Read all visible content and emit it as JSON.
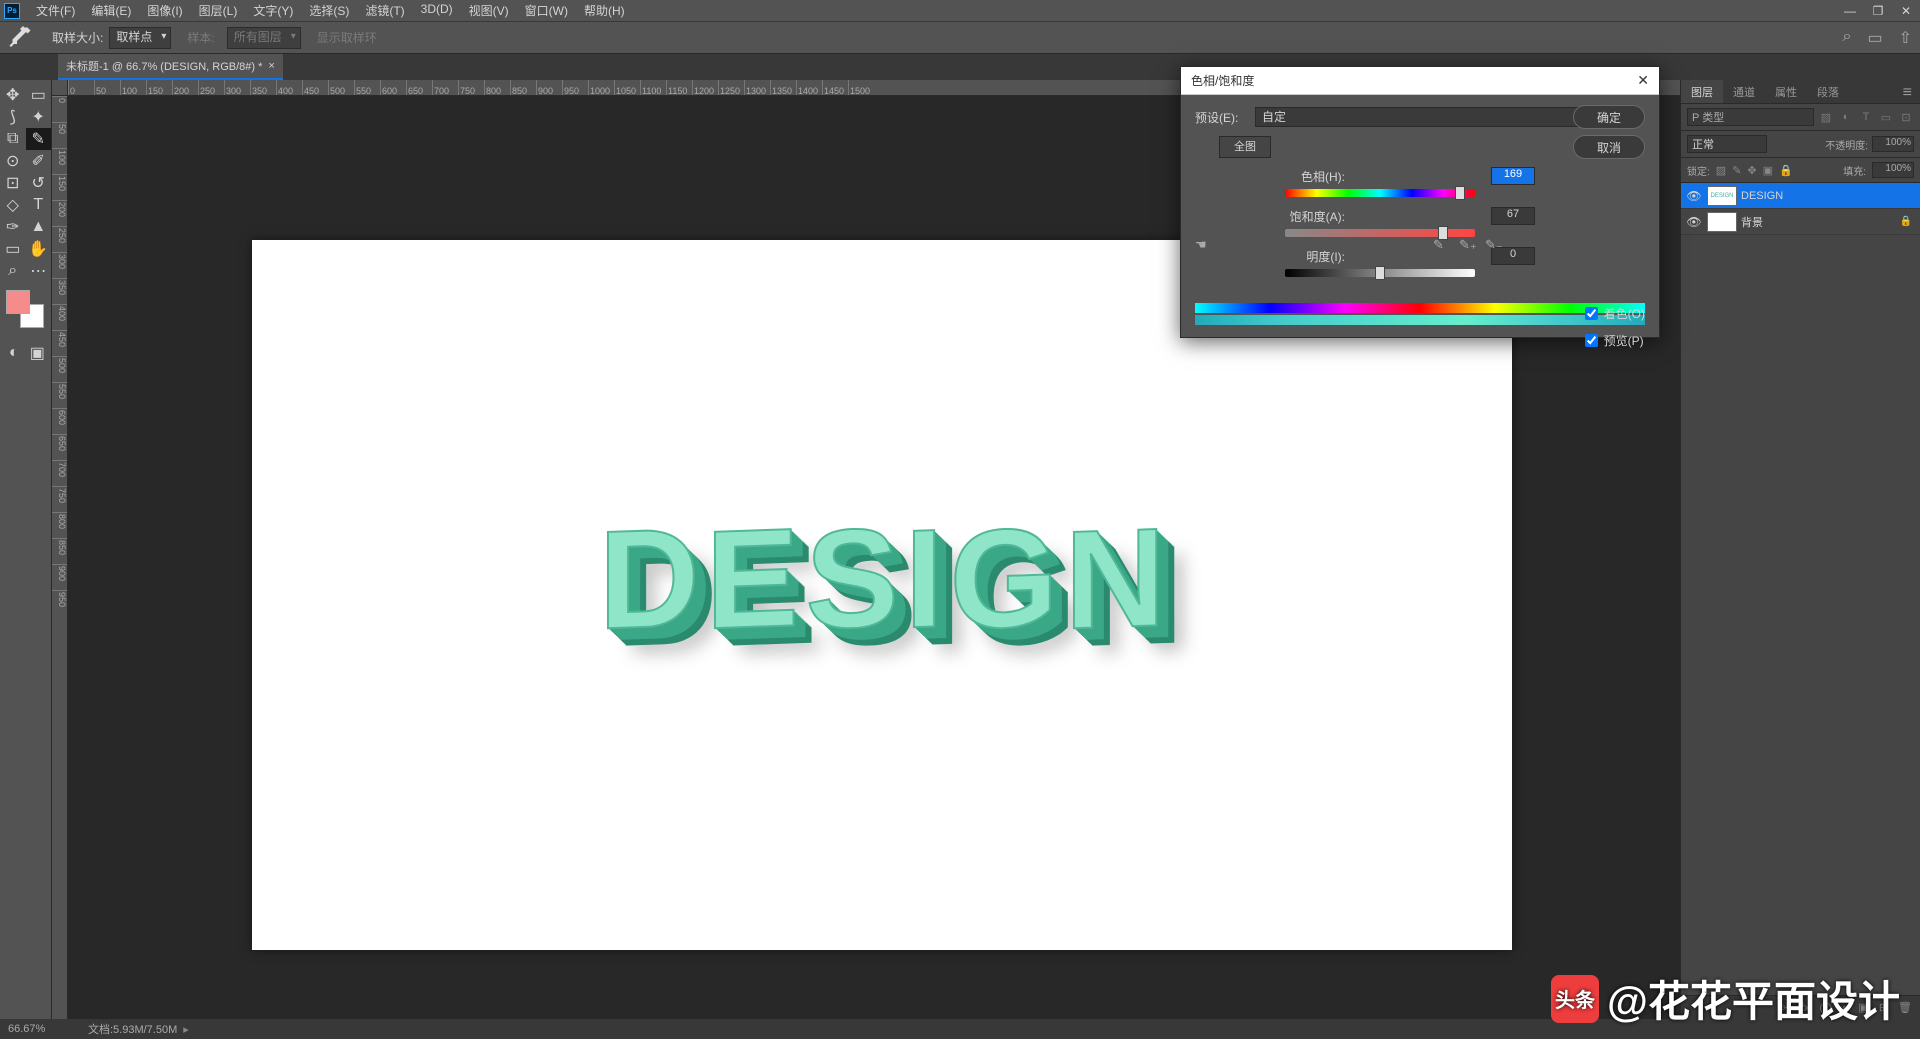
{
  "menus": [
    "文件(F)",
    "编辑(E)",
    "图像(I)",
    "图层(L)",
    "文字(Y)",
    "选择(S)",
    "滤镜(T)",
    "3D(D)",
    "视图(V)",
    "窗口(W)",
    "帮助(H)"
  ],
  "options": {
    "sample_label": "取样大小:",
    "sample_value": "取样点",
    "sample2_label": "样本:",
    "sample2_value": "所有图层",
    "ring_label": "显示取样环"
  },
  "tab": {
    "title": "未标题-1 @ 66.7% (DESIGN, RGB/8#) *"
  },
  "ruler_marks": [
    0,
    50,
    100,
    150,
    200,
    250,
    300,
    350,
    400,
    450,
    500,
    550,
    600,
    650,
    700,
    750,
    800,
    850,
    900,
    950,
    1000,
    1050,
    1100,
    1150,
    1200,
    1250,
    1300,
    1350,
    1400,
    1450,
    1500
  ],
  "ruler_v_marks": [
    0,
    50,
    100,
    150,
    200,
    250,
    300,
    350,
    400,
    450,
    500,
    550,
    600,
    650,
    700,
    750,
    800,
    850,
    900,
    950
  ],
  "canvas_text": "DESIGN",
  "dialog": {
    "title": "色相/饱和度",
    "preset_label": "预设(E):",
    "preset_value": "自定",
    "ok": "确定",
    "cancel": "取消",
    "edit_tab": "全图",
    "hue_label": "色相(H):",
    "hue_value": "169",
    "sat_label": "饱和度(A):",
    "sat_value": "67",
    "light_label": "明度(I):",
    "light_value": "0",
    "colorize": "着色(O)",
    "preview": "预览(P)"
  },
  "panels": {
    "tabs": [
      "图层",
      "通道",
      "属性",
      "段落"
    ],
    "search_type": "P 类型",
    "blend_mode": "正常",
    "opacity_label": "不透明度:",
    "opacity_value": "100%",
    "lock_label": "锁定:",
    "fill_label": "填充:",
    "fill_value": "100%",
    "layers": [
      {
        "name": "DESIGN",
        "selected": true
      },
      {
        "name": "背景",
        "locked": true
      }
    ]
  },
  "status": {
    "zoom": "66.67%",
    "doc": "文档:5.93M/7.50M"
  },
  "watermark": {
    "label": "头条",
    "author": "@花花平面设计"
  }
}
